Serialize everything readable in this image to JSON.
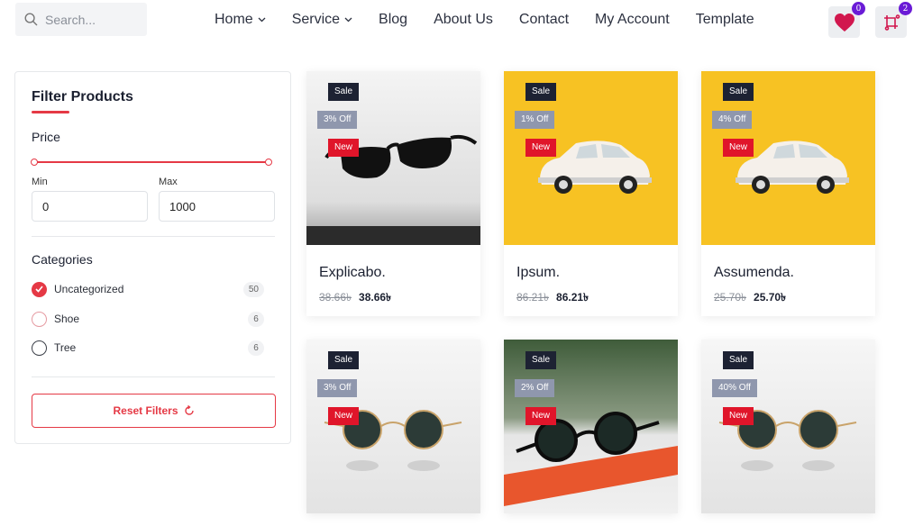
{
  "header": {
    "search_placeholder": "Search...",
    "menu": [
      {
        "label": "Home",
        "dropdown": true
      },
      {
        "label": "Service",
        "dropdown": true
      },
      {
        "label": "Blog",
        "dropdown": false
      },
      {
        "label": "About Us",
        "dropdown": false
      },
      {
        "label": "Contact",
        "dropdown": false
      },
      {
        "label": "My Account",
        "dropdown": false
      },
      {
        "label": "Template",
        "dropdown": false
      }
    ],
    "wishlist_count": "0",
    "compare_count": "2",
    "colors": {
      "heart": "#d1174e",
      "compare": "#d1174e",
      "badge": "#6a1bd6"
    }
  },
  "filter": {
    "title": "Filter Products",
    "price_label": "Price",
    "min_label": "Min",
    "max_label": "Max",
    "min_value": "0",
    "max_value": "1000",
    "categories_label": "Categories",
    "categories": [
      {
        "name": "Uncategorized",
        "count": "50",
        "state": "checked"
      },
      {
        "name": "Shoe",
        "count": "6",
        "state": "hover"
      },
      {
        "name": "Tree",
        "count": "6",
        "state": "unchecked"
      }
    ],
    "reset_label": "Reset Filters",
    "accent": "#e53945"
  },
  "products": [
    {
      "name": "Explicabo.",
      "old_price": "38.66৳",
      "price": "38.66৳",
      "sale": "Sale",
      "off": "3% Off",
      "new": "New",
      "image": "sunglasses-on-white",
      "bg": "#d9d9d9"
    },
    {
      "name": "Ipsum.",
      "old_price": "86.21৳",
      "price": "86.21৳",
      "sale": "Sale",
      "off": "1% Off",
      "new": "New",
      "image": "car-on-yellow",
      "bg": "#f7c223"
    },
    {
      "name": "Assumenda.",
      "old_price": "25.70৳",
      "price": "25.70৳",
      "sale": "Sale",
      "off": "4% Off",
      "new": "New",
      "image": "car-on-yellow",
      "bg": "#f7c223"
    },
    {
      "name": "",
      "old_price": "",
      "price": "",
      "sale": "Sale",
      "off": "3% Off",
      "new": "New",
      "image": "round-sunglasses",
      "bg": "#ececec"
    },
    {
      "name": "",
      "old_price": "",
      "price": "",
      "sale": "Sale",
      "off": "2% Off",
      "new": "New",
      "image": "sunglasses-on-supreme",
      "bg": "#3c5a3a"
    },
    {
      "name": "",
      "old_price": "",
      "price": "",
      "sale": "Sale",
      "off": "40% Off",
      "new": "New",
      "image": "round-sunglasses",
      "bg": "#ececec"
    }
  ]
}
